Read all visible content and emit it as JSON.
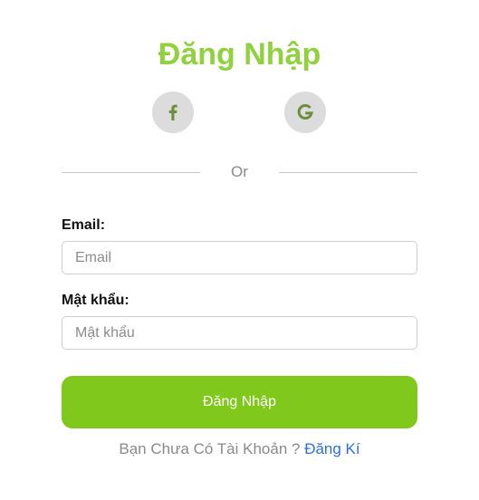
{
  "colors": {
    "title": "#8fd23d",
    "button_bg": "#80c81c",
    "icon": "#6d8f3d",
    "link": "#2f6fe0"
  },
  "header": {
    "title": "Đăng Nhập"
  },
  "social": {
    "facebook_icon": "facebook-icon",
    "google_icon": "google-icon"
  },
  "divider": {
    "text": "Or"
  },
  "form": {
    "email_label": "Email:",
    "email_placeholder": "Email",
    "email_value": "",
    "password_label": "Mật khẩu:",
    "password_placeholder": "Mật khẩu",
    "password_value": "",
    "submit_label": "Đăng Nhập"
  },
  "footer": {
    "prompt": "Bạn Chưa Có Tài Khoản ? ",
    "signup_link": "Đăng Kí"
  }
}
